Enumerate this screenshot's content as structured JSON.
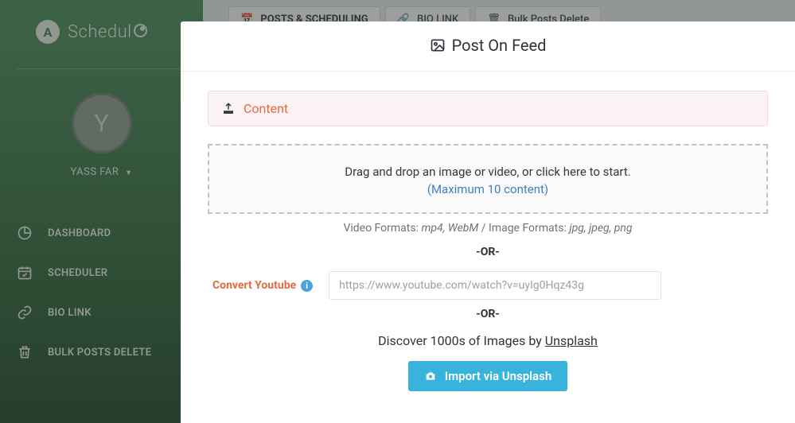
{
  "brand": {
    "name": "Schedul",
    "mark_letter": "A"
  },
  "user": {
    "initial": "Y",
    "name": "YASS FAR"
  },
  "sidebar": {
    "items": [
      {
        "label": "DASHBOARD",
        "has_chevron": false
      },
      {
        "label": "SCHEDULER",
        "has_chevron": true
      },
      {
        "label": "BIO LINK",
        "has_chevron": true
      },
      {
        "label": "BULK POSTS DELETE",
        "has_chevron": true
      }
    ]
  },
  "tabs": [
    {
      "label": "POSTS & SCHEDULING"
    },
    {
      "label": "BIO LINK"
    },
    {
      "label": "Bulk Posts Delete"
    }
  ],
  "modal": {
    "title": "Post On Feed",
    "content_label": "Content",
    "dropzone_text": "Drag and drop an image or video, or click here to start.",
    "dropzone_max": "(Maximum 10 content)",
    "formats_video_label": "Video Formats:",
    "formats_video": "mp4, WebM",
    "formats_sep": "/",
    "formats_image_label": "Image Formats:",
    "formats_image": "jpg, jpeg, png",
    "or": "-OR-",
    "youtube_label": "Convert Youtube",
    "youtube_placeholder": "https://www.youtube.com/watch?v=uyIg0Hqz43g",
    "discover_prefix": "Discover 1000s of Images by ",
    "discover_link": "Unsplash",
    "import_button": "Import via Unsplash"
  }
}
